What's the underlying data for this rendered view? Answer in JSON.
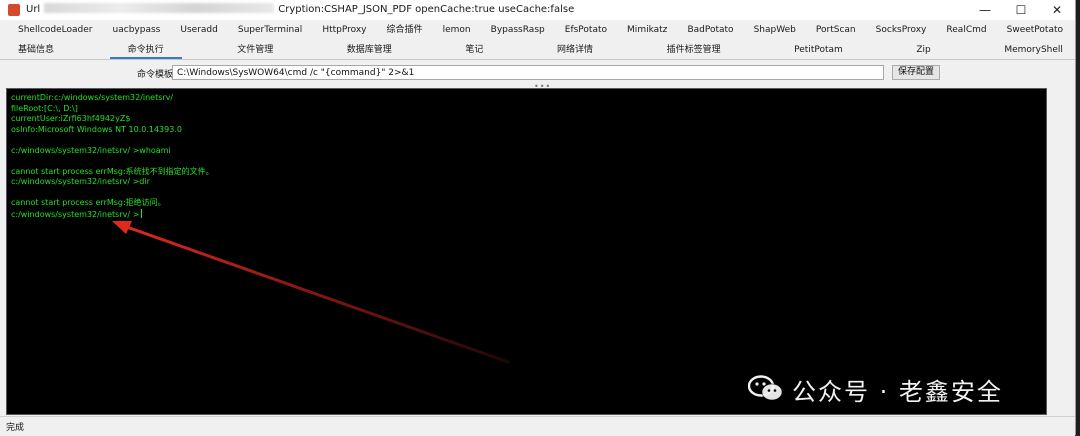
{
  "window": {
    "title_prefix": "Url",
    "title_suffix": "Cryption:CSHAP_JSON_PDF openCache:true useCache:false",
    "controls": {
      "minimize": "—",
      "maximize": "☐",
      "close": "✕"
    }
  },
  "tabs_row1": [
    "ShellcodeLoader",
    "uacbypass",
    "Useradd",
    "SuperTerminal",
    "HttpProxy",
    "综合插件",
    "lemon",
    "BypassRasp",
    "EfsPotato",
    "Mimikatz",
    "BadPotato",
    "ShapWeb",
    "PortScan",
    "SocksProxy",
    "RealCmd",
    "SweetPotato"
  ],
  "tabs_row2": [
    "基础信息",
    "命令执行",
    "文件管理",
    "数据库管理",
    "笔记",
    "网络详情",
    "插件标签管理",
    "PetitPotam",
    "Zip",
    "MemoryShell"
  ],
  "active_tab": "命令执行",
  "command": {
    "label": "命令模板",
    "value": "C:\\Windows\\SysWOW64\\cmd /c \"{command}\" 2>&1",
    "save_button": "保存配置"
  },
  "splitter": "•••",
  "console": {
    "text_color": "#22e122",
    "lines": [
      "currentDir:c:/windows/system32/inetsrv/",
      "fileRoot:[C:\\, D:\\]",
      "currentUser:iZrfi63hf4942yZ$",
      "osInfo:Microsoft Windows NT 10.0.14393.0",
      "",
      "c:/windows/system32/inetsrv/ >whoami",
      "",
      "cannot start process errMsg:系统找不到指定的文件。",
      "c:/windows/system32/inetsrv/ >dir",
      "",
      "cannot start process errMsg:拒绝访问。",
      "c:/windows/system32/inetsrv/ >"
    ]
  },
  "status": "完成",
  "annotation_color": "#e02a1f",
  "watermark": {
    "icon": "wechat-icon",
    "text": "公众号 · 老鑫安全"
  }
}
